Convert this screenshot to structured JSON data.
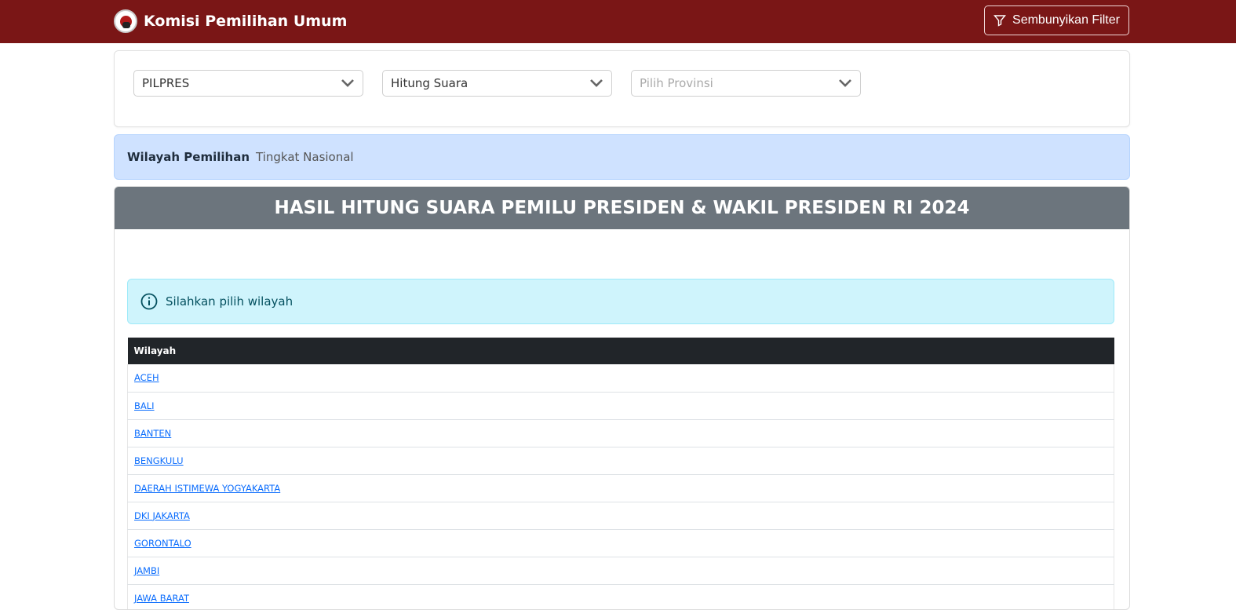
{
  "header": {
    "brand": "Komisi Pemilihan Umum",
    "filter_button": "Sembunyikan Filter"
  },
  "filters": {
    "election": "PILPRES",
    "type": "Hitung Suara",
    "province_placeholder": "Pilih Provinsi"
  },
  "region": {
    "label": "Wilayah Pemilihan",
    "value": "Tingkat Nasional"
  },
  "main": {
    "title": "HASIL HITUNG SUARA PEMILU PRESIDEN & WAKIL PRESIDEN RI 2024",
    "info": "Silahkan pilih wilayah"
  },
  "table": {
    "header": "Wilayah",
    "rows": [
      "ACEH",
      "BALI",
      "BANTEN",
      "BENGKULU",
      "DAERAH ISTIMEWA YOGYAKARTA",
      "DKI JAKARTA",
      "GORONTALO",
      "JAMBI",
      "JAWA BARAT"
    ]
  },
  "colors": {
    "brand": "#7a1616",
    "header_bar": "#6c757d",
    "info_bg": "#cff4fc",
    "region_bg": "#cfe2ff",
    "link": "#0d6efd"
  }
}
